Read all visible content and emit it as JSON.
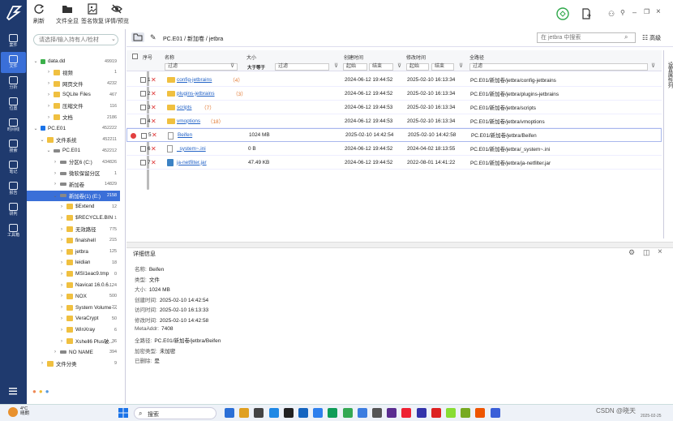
{
  "rail": {
    "items": [
      {
        "label": "案件",
        "icon": "case-icon"
      },
      {
        "label": "文件",
        "icon": "file-icon",
        "active": true
      },
      {
        "label": "分析",
        "icon": "analysis-icon"
      },
      {
        "label": "位置",
        "icon": "location-icon"
      },
      {
        "label": "时间线",
        "icon": "timeline-icon"
      },
      {
        "label": "搜索",
        "icon": "search-icon"
      },
      {
        "label": "笔记",
        "icon": "note-icon"
      },
      {
        "label": "报告",
        "icon": "report-icon"
      },
      {
        "label": "研判",
        "icon": "judge-icon"
      },
      {
        "label": "工具箱",
        "icon": "toolbox-icon"
      }
    ]
  },
  "toolbar": {
    "refresh": "刷新",
    "all_files": "文件全显",
    "sig_recover": "签名恢复",
    "detail_preview": "详情/预览"
  },
  "left": {
    "search_placeholder": "请选择/输入持有人/检材",
    "tree": [
      {
        "label": "data.dd",
        "count": "49919",
        "indent": 1,
        "open": true
      },
      {
        "label": "视频",
        "count": "1",
        "indent": 3
      },
      {
        "label": "网页文件",
        "count": "4232",
        "indent": 3
      },
      {
        "label": "SQLite Files",
        "count": "467",
        "indent": 3
      },
      {
        "label": "压缩文件",
        "count": "116",
        "indent": 3
      },
      {
        "label": "文档",
        "count": "2186",
        "indent": 3
      },
      {
        "label": "PC.E01",
        "count": "452222",
        "indent": 1,
        "open": true
      },
      {
        "label": "文件系统",
        "count": "452211",
        "indent": 2,
        "open": true
      },
      {
        "label": "PC.E01",
        "count": "452212",
        "indent": 3,
        "open": true
      },
      {
        "label": "分区6 (C:)",
        "count": "434826",
        "indent": 4
      },
      {
        "label": "微软保留分区",
        "count": "1",
        "indent": 4
      },
      {
        "label": "新加卷",
        "count": "14829",
        "indent": 4
      },
      {
        "label": "新加卷(1) (E:)",
        "count": "2158",
        "indent": 4,
        "sel": true,
        "open": true
      },
      {
        "label": "$Extend",
        "count": "12",
        "indent": 5
      },
      {
        "label": "$RECYCLE.BIN",
        "count": "1",
        "indent": 5
      },
      {
        "label": "无效路径",
        "count": "775",
        "indent": 5
      },
      {
        "label": "finalshell",
        "count": "215",
        "indent": 5
      },
      {
        "label": "jetbra",
        "count": "125",
        "indent": 5
      },
      {
        "label": "leidian",
        "count": "18",
        "indent": 5
      },
      {
        "label": "MSI1eac9.tmp",
        "count": "0",
        "indent": 5
      },
      {
        "label": "Navicat 16.0.6...",
        "count": "124",
        "indent": 5
      },
      {
        "label": "NOX",
        "count": "500",
        "indent": 5
      },
      {
        "label": "System Volume ...",
        "count": "22",
        "indent": 5
      },
      {
        "label": "VeraCrypt",
        "count": "50",
        "indent": 5
      },
      {
        "label": "WinXray",
        "count": "6",
        "indent": 5
      },
      {
        "label": "Xshell6 Plus破...",
        "count": "36",
        "indent": 5
      },
      {
        "label": "NO NAME",
        "count": "394",
        "indent": 4
      },
      {
        "label": "文件分类",
        "count": "9",
        "indent": 2
      }
    ]
  },
  "path": {
    "crumbs": [
      "PC.E01",
      "新加卷",
      "jetbra"
    ],
    "search_placeholder": "在 jetbra 中搜索",
    "advanced": "高级"
  },
  "table": {
    "headers": {
      "index": "序号",
      "name": "名称",
      "size": "大小",
      "created": "创建时间",
      "modified": "修改时间",
      "fullpath": "全路径"
    },
    "filter": {
      "name": "过滤",
      "size_op": "大于等于",
      "size": "过滤",
      "start": "起始",
      "end": "结束",
      "path": "过滤"
    },
    "rows": [
      {
        "idx": "1",
        "name": "config-jetbrains",
        "cnt": "（4）",
        "size": "",
        "created": "2024-06-12 19:44:52",
        "modified": "2025-02-10 16:13:34",
        "path": "PC.E01/新加卷/jetbra/config-jetbrains",
        "type": "folder"
      },
      {
        "idx": "2",
        "name": "plugins-jetbrains",
        "cnt": "（3）",
        "size": "",
        "created": "2024-06-12 19:44:52",
        "modified": "2025-02-10 16:13:34",
        "path": "PC.E01/新加卷/jetbra/plugins-jetbrains",
        "type": "folder"
      },
      {
        "idx": "3",
        "name": "scripts",
        "cnt": "（7）",
        "size": "",
        "created": "2024-06-12 19:44:53",
        "modified": "2025-02-10 16:13:34",
        "path": "PC.E01/新加卷/jetbra/scripts",
        "type": "folder"
      },
      {
        "idx": "4",
        "name": "vmoptions",
        "cnt": "（18）",
        "size": "",
        "created": "2024-06-12 19:44:53",
        "modified": "2025-02-10 16:13:34",
        "path": "PC.E01/新加卷/jetbra/vmoptions",
        "type": "folder"
      },
      {
        "idx": "5",
        "name": "Beifen",
        "cnt": "",
        "size": "1024 MB",
        "created": "2025-02-10 14:42:54",
        "modified": "2025-02-10 14:42:58",
        "path": "PC.E01/新加卷/jetbra/Beifen",
        "type": "file"
      },
      {
        "idx": "6",
        "name": "_system~.ini",
        "cnt": "",
        "size": "0 B",
        "created": "2024-06-12 19:44:52",
        "modified": "2024-04-02 18:13:55",
        "path": "PC.E01/新加卷/jetbra/_system~.ini",
        "type": "file"
      },
      {
        "idx": "7",
        "name": "ja-netfilter.jar",
        "cnt": "",
        "size": "47.49 KB",
        "created": "2024-06-12 19:44:52",
        "modified": "2022-08-01 14:41:22",
        "path": "PC.E01/新加卷/jetbra/ja-netfilter.jar",
        "type": "jar"
      }
    ]
  },
  "sidepanel": "设置属性列",
  "detail": {
    "title": "详细信息",
    "lines": [
      {
        "k": "名称:",
        "v": "Beifen"
      },
      {
        "k": "类型:",
        "v": "文件"
      },
      {
        "k": "大小:",
        "v": "1024 MB"
      },
      {
        "k": "创建时间:",
        "v": "2025-02-10 14:42:54"
      },
      {
        "k": "访问时间:",
        "v": "2025-02-10 16:13:33"
      },
      {
        "k": "修改时间:",
        "v": "2025-02-10 14:42:58"
      },
      {
        "k": "MetaAddr:",
        "v": "7408"
      },
      {
        "k": "全路径:",
        "v": "PC.E01/新加卷/jetbra/Beifen"
      },
      {
        "k": "加密类型:",
        "v": "未加密"
      },
      {
        "k": "已删除:",
        "v": "是"
      }
    ]
  },
  "taskbar": {
    "weather_temp": "4°C",
    "weather_desc": "晴朗",
    "search": "搜索",
    "watermark": "CSDN @晓天",
    "date": "2025-02-25"
  },
  "colors": {
    "rail": "#1f3a6e",
    "accent": "#3a6fd8",
    "link": "#2262c7",
    "count": "#e0742a",
    "delete": "#d33"
  }
}
